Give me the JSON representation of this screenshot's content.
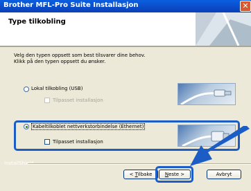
{
  "window": {
    "title": "Brother MFL-Pro Suite Installasjon",
    "close_symbol": "✕"
  },
  "header": {
    "title": "Type tilkobling"
  },
  "main": {
    "instructions": [
      "Velg den typen oppsett som best tilsvarer dine behov.",
      "Klikk på den typen oppsett du ønsker."
    ],
    "options": [
      {
        "label": "Lokal tilkobling (USB)",
        "selected": false,
        "sub_checkbox_label": "Tilpasset installasjon",
        "sub_checkbox_enabled": false,
        "image_icon": "usb-cable-icon"
      },
      {
        "label": "Kabeltilkoblet nettverkstorbindelse (Ethernet)",
        "selected": true,
        "sub_checkbox_label": "Tilpasset installasjon",
        "sub_checkbox_enabled": true,
        "image_icon": "ethernet-cable-icon"
      }
    ],
    "installshield_label": "InstallShield"
  },
  "footer": {
    "back_prefix": "< ",
    "back_key": "T",
    "back_rest": "ilbake",
    "next_key": "N",
    "next_rest": "este >",
    "cancel_label": "Avbryt"
  },
  "colors": {
    "highlight": "#1c5cc5",
    "title_bar": "#0a5fe0"
  }
}
